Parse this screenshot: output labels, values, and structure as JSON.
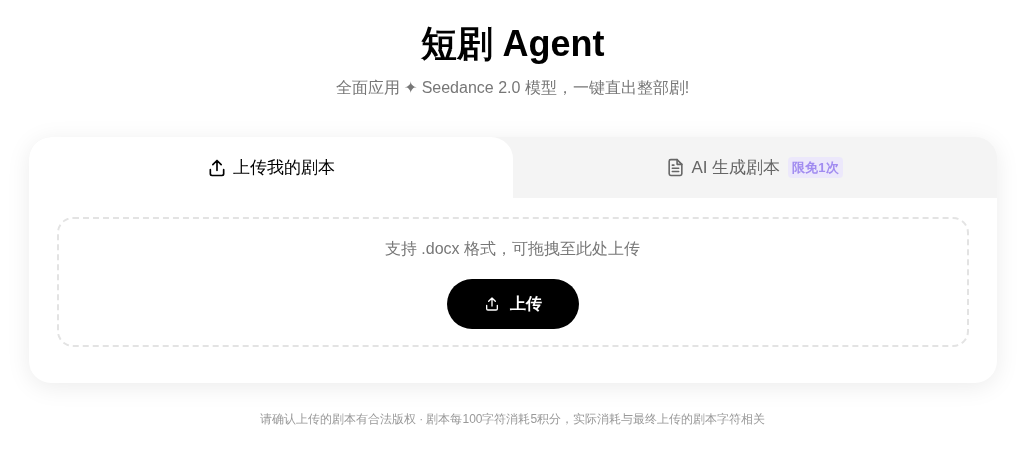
{
  "header": {
    "title": "短剧 Agent",
    "subtitle": "全面应用 ✦ Seedance 2.0 模型，一键直出整部剧!"
  },
  "tabs": [
    {
      "kind": "upload",
      "label": "上传我的剧本",
      "selected": true
    },
    {
      "kind": "generate",
      "label": "AI 生成剧本",
      "badge": "限免1次",
      "selected": false
    }
  ],
  "dropzone": {
    "hint": "支持 .docx 格式，可拖拽至此处上传",
    "button": "上传"
  },
  "footer": "请确认上传的剧本有合法版权 · 剧本每100字符消耗5积分，实际消耗与最终上传的剧本字符相关"
}
